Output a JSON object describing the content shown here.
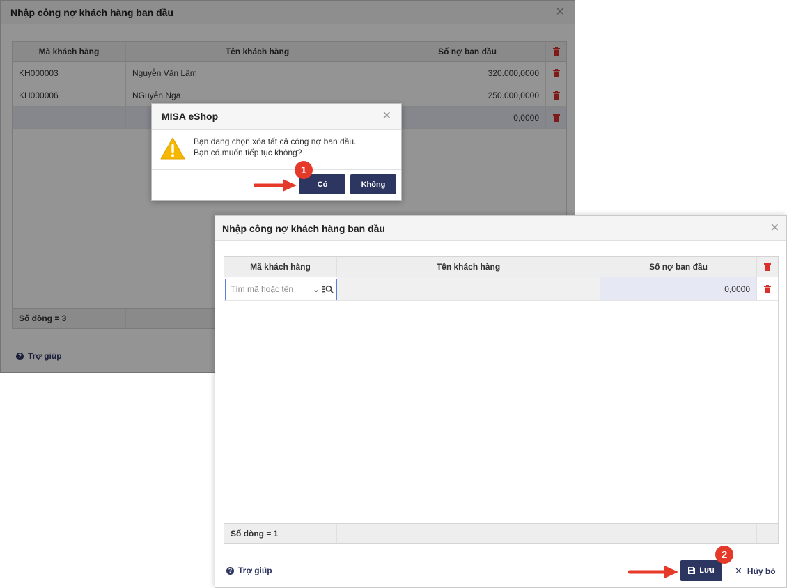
{
  "back_dialog": {
    "title": "Nhập công nợ khách hàng ban đầu",
    "columns": [
      "Mã khách hàng",
      "Tên khách hàng",
      "Số nợ ban đầu"
    ],
    "rows": [
      {
        "code": "KH000003",
        "name": "Nguyễn Văn Lâm",
        "amount": "320.000,0000"
      },
      {
        "code": "KH000006",
        "name": "NGuyễn Nga",
        "amount": "250.000,0000"
      },
      {
        "code": "",
        "name": "",
        "amount": "0,0000"
      }
    ],
    "row_count": "Số dòng = 3",
    "help_label": "Trợ giúp"
  },
  "confirm": {
    "title": "MISA eShop",
    "message_line1": "Bạn đang chọn xóa tất cả công nợ ban đầu.",
    "message_line2": "Bạn có muốn tiếp tục không?",
    "yes_label": "Có",
    "no_label": "Không"
  },
  "front_dialog": {
    "title": "Nhập công nợ khách hàng ban đầu",
    "columns": [
      "Mã khách hàng",
      "Tên khách hàng",
      "Số nợ ban đầu"
    ],
    "search_placeholder": "Tìm mã hoặc tên",
    "row_amount": "0,0000",
    "row_count": "Số dòng = 1",
    "help_label": "Trợ giúp",
    "save_label": "Lưu",
    "cancel_label": "Hủy bỏ"
  },
  "annotations": {
    "step1": "1",
    "step2": "2"
  },
  "colors": {
    "primary": "#2d3561",
    "delete": "#d9302c",
    "badge": "#e53a2a",
    "warning": "#f5b700"
  },
  "icons": [
    "close-icon",
    "trash-icon",
    "warning-icon",
    "help-icon",
    "chevron-down-icon",
    "search-list-icon",
    "save-icon",
    "cancel-icon"
  ]
}
